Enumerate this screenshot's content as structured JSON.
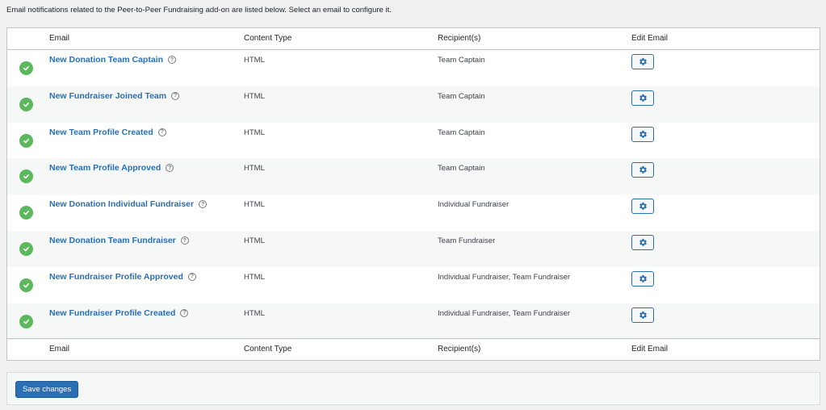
{
  "intro": "Email notifications related to the Peer-to-Peer Fundraising add-on are listed below. Select an email to configure it.",
  "columns": {
    "email": "Email",
    "content_type": "Content Type",
    "recipients": "Recipient(s)",
    "edit": "Edit Email"
  },
  "emails": [
    {
      "name": "New Donation Team Captain",
      "content_type": "HTML",
      "recipients": "Team Captain",
      "status": "enabled"
    },
    {
      "name": "New Fundraiser Joined Team",
      "content_type": "HTML",
      "recipients": "Team Captain",
      "status": "enabled"
    },
    {
      "name": "New Team Profile Created",
      "content_type": "HTML",
      "recipients": "Team Captain",
      "status": "enabled"
    },
    {
      "name": "New Team Profile Approved",
      "content_type": "HTML",
      "recipients": "Team Captain",
      "status": "enabled"
    },
    {
      "name": "New Donation Individual Fundraiser",
      "content_type": "HTML",
      "recipients": "Individual Fundraiser",
      "status": "enabled"
    },
    {
      "name": "New Donation Team Fundraiser",
      "content_type": "HTML",
      "recipients": "Team Fundraiser",
      "status": "enabled"
    },
    {
      "name": "New Fundraiser Profile Approved",
      "content_type": "HTML",
      "recipients": "Individual Fundraiser, Team Fundraiser",
      "status": "enabled"
    },
    {
      "name": "New Fundraiser Profile Created",
      "content_type": "HTML",
      "recipients": "Individual Fundraiser, Team Fundraiser",
      "status": "enabled"
    }
  ],
  "save_label": "Save changes",
  "icons": {
    "status": "check-circle-icon",
    "help": "question-circle-icon",
    "edit": "gear-icon"
  },
  "colors": {
    "link": "#2a6eb4",
    "status_enabled": "#5cb85c",
    "primary_button": "#2a6eb4"
  }
}
